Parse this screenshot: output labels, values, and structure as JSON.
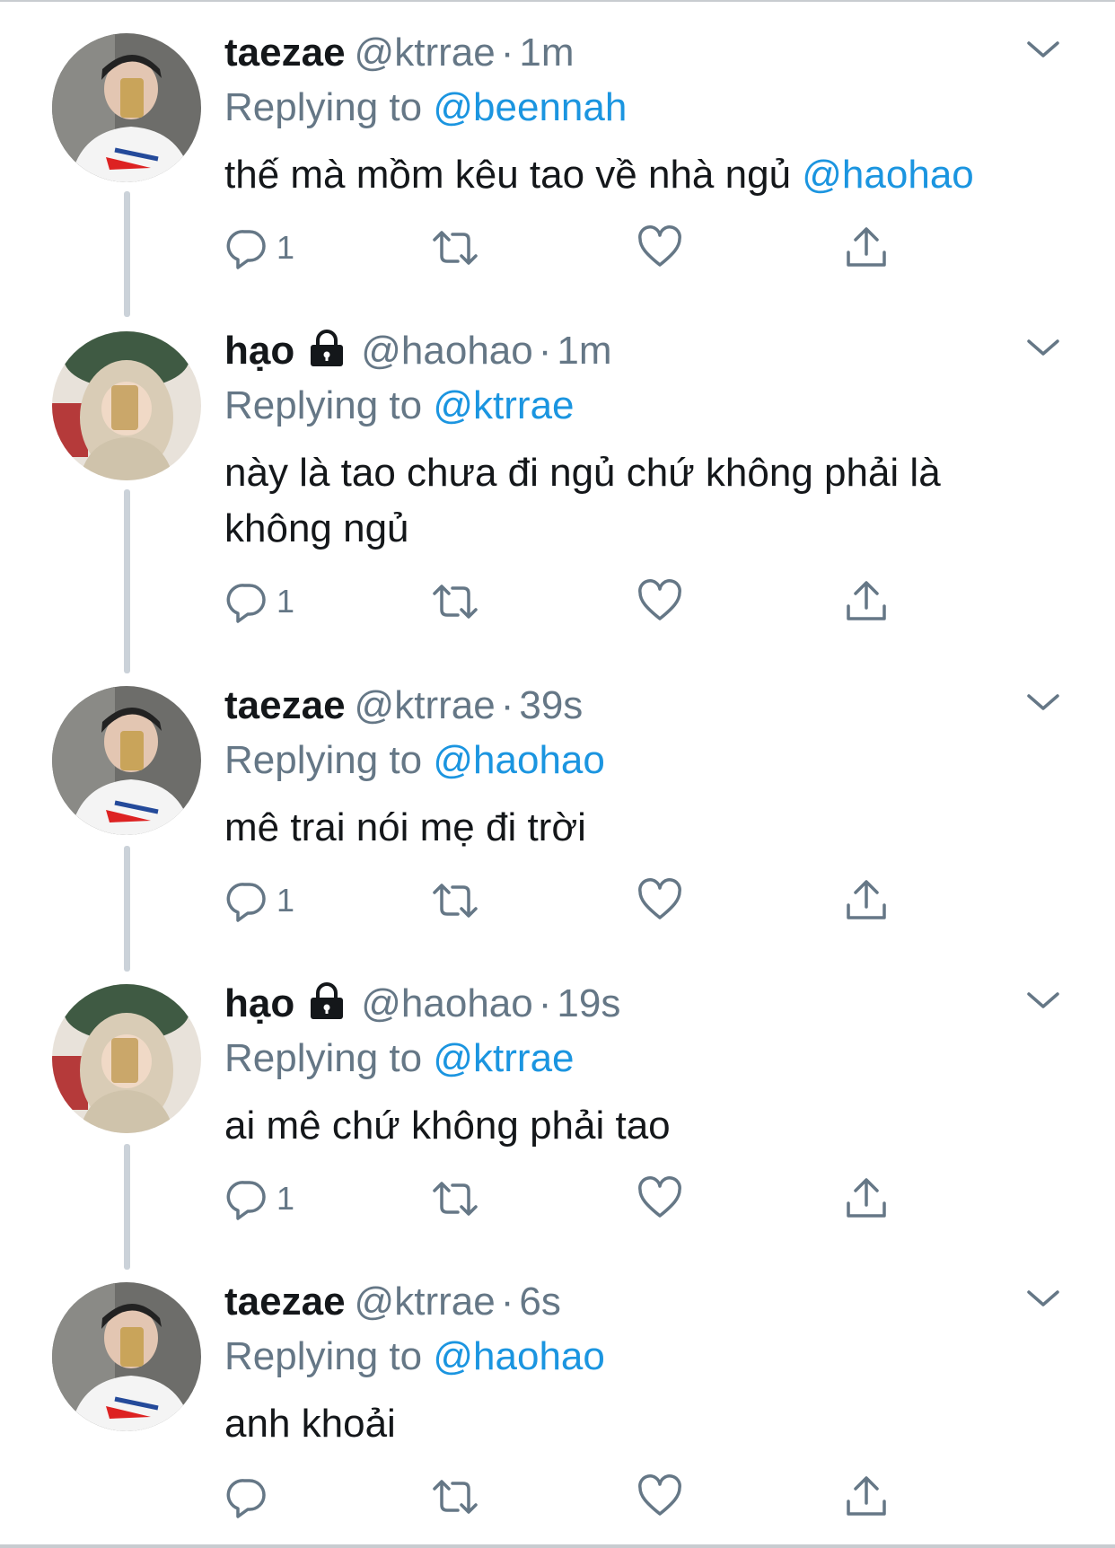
{
  "tweets": [
    {
      "name": "taezae",
      "handle": "@ktrrae",
      "dot": "·",
      "time": "1m",
      "locked": false,
      "replying_label": "Replying to",
      "replying_to": "@beennah",
      "text": "thế mà mồm kêu tao về nhà ngủ ",
      "text_mention": "@haohao",
      "reply_count": "1"
    },
    {
      "name": "hạo",
      "handle": "@haohao",
      "dot": "·",
      "time": "1m",
      "locked": true,
      "replying_label": "Replying to",
      "replying_to": "@ktrrae",
      "text": "này là tao chưa đi ngủ chứ không phải là không ngủ",
      "text_mention": "",
      "reply_count": "1"
    },
    {
      "name": "taezae",
      "handle": "@ktrrae",
      "dot": "·",
      "time": "39s",
      "locked": false,
      "replying_label": "Replying to",
      "replying_to": "@haohao",
      "text": "mê trai nói mẹ đi trời",
      "text_mention": "",
      "reply_count": "1"
    },
    {
      "name": "hạo",
      "handle": "@haohao",
      "dot": "·",
      "time": "19s",
      "locked": true,
      "replying_label": "Replying to",
      "replying_to": "@ktrrae",
      "text": "ai mê chứ không phải tao",
      "text_mention": "",
      "reply_count": "1"
    },
    {
      "name": "taezae",
      "handle": "@ktrrae",
      "dot": "·",
      "time": "6s",
      "locked": false,
      "replying_label": "Replying to",
      "replying_to": "@haohao",
      "text": "anh khoải",
      "text_mention": "",
      "reply_count": ""
    }
  ],
  "icons": {
    "reply": "reply-icon",
    "retweet": "retweet-icon",
    "like": "heart-icon",
    "share": "share-icon",
    "more": "chevron-down-icon",
    "lock": "lock-icon"
  },
  "colors": {
    "mention": "#1b95e0",
    "secondary": "#657786",
    "text": "#14171a",
    "thread_line": "#cbd2d9"
  }
}
